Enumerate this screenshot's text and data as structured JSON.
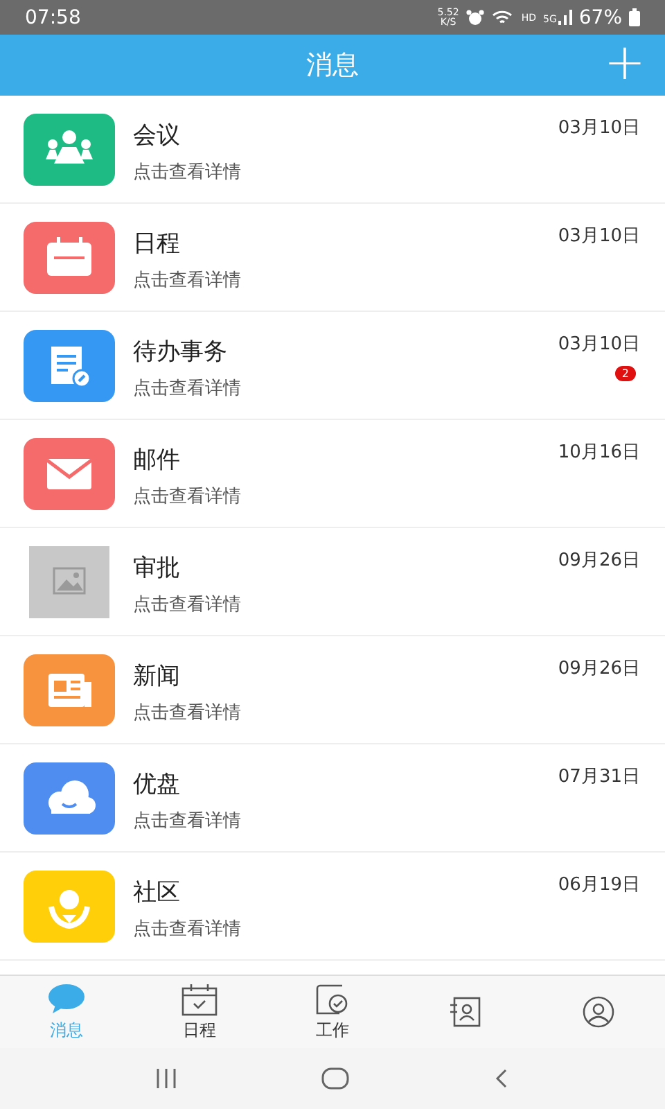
{
  "status_bar": {
    "time": "07:58",
    "speed": "5.52",
    "speed_unit": "K/S",
    "hd": "HD",
    "network": "5G",
    "battery": "67%"
  },
  "header": {
    "title": "消息",
    "add_button": "+"
  },
  "messages": [
    {
      "kind": "meeting",
      "color": "#1fbb85",
      "title": "会议",
      "subtitle": "点击查看详情",
      "date": "03月10日"
    },
    {
      "kind": "calendar",
      "color": "#f56a6a",
      "title": "日程",
      "subtitle": "点击查看详情",
      "date": "03月10日"
    },
    {
      "kind": "todo",
      "color": "#3598f3",
      "title": "待办事务",
      "subtitle": "点击查看详情",
      "date": "03月10日",
      "badge": "2"
    },
    {
      "kind": "mail",
      "color": "#f56a6a",
      "title": "邮件",
      "subtitle": "点击查看详情",
      "date": "10月16日"
    },
    {
      "kind": "picture",
      "title": "审批",
      "subtitle": "点击查看详情",
      "date": "09月26日"
    },
    {
      "kind": "news",
      "color": "#f7923f",
      "title": "新闻",
      "subtitle": "点击查看详情",
      "date": "09月26日"
    },
    {
      "kind": "cloud",
      "color": "#4f8ef0",
      "title": "优盘",
      "subtitle": "点击查看详情",
      "date": "07月31日"
    },
    {
      "kind": "community",
      "color": "#ffcf0a",
      "title": "社区",
      "subtitle": "点击查看详情",
      "date": "06月19日"
    }
  ],
  "tabs": [
    {
      "kind": "chat",
      "label": "消息",
      "selected": true
    },
    {
      "kind": "calendar",
      "label": "日程",
      "selected": false
    },
    {
      "kind": "work",
      "label": "工作",
      "selected": false
    },
    {
      "kind": "contacts",
      "selected": false
    },
    {
      "kind": "profile",
      "selected": false
    }
  ]
}
